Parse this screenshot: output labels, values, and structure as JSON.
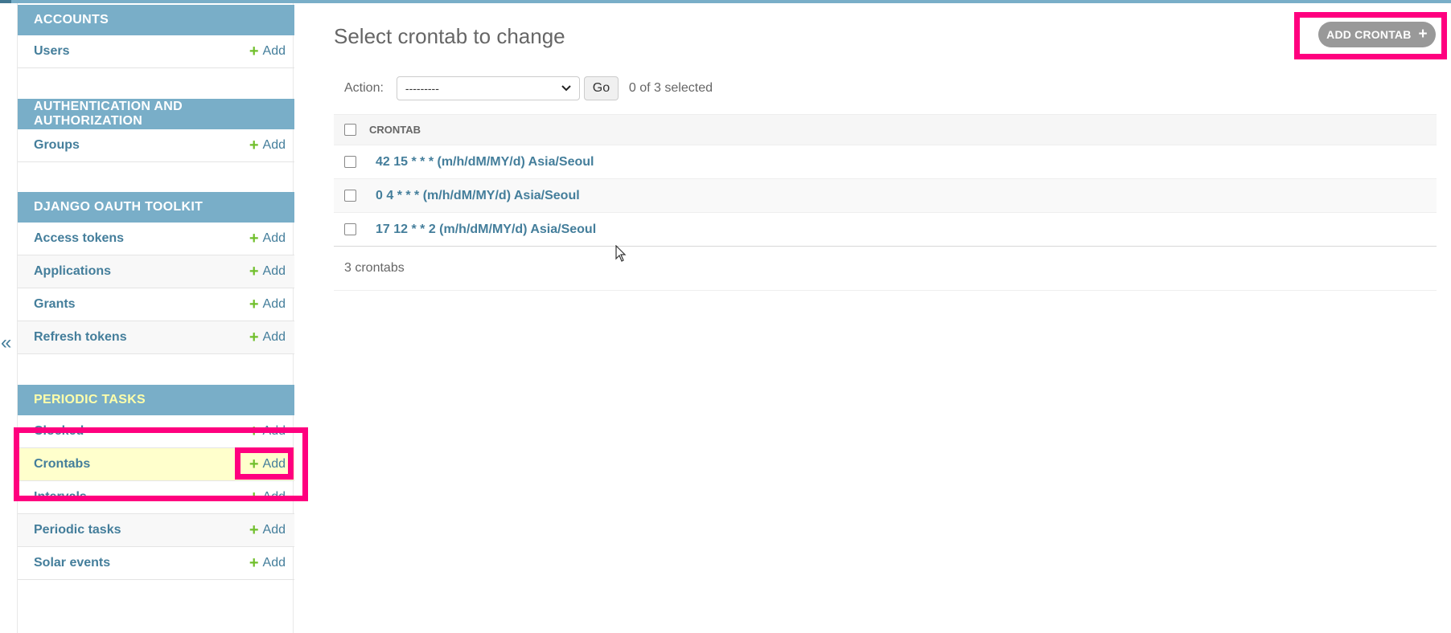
{
  "sidebar": {
    "collapse_toggle": "«",
    "modules": [
      {
        "caption": "ACCOUNTS",
        "rows": [
          {
            "label": "Users",
            "add": "Add"
          }
        ]
      },
      {
        "caption": "AUTHENTICATION AND AUTHORIZATION",
        "rows": [
          {
            "label": "Groups",
            "add": "Add"
          }
        ]
      },
      {
        "caption": "DJANGO OAUTH TOOLKIT",
        "rows": [
          {
            "label": "Access tokens",
            "add": "Add"
          },
          {
            "label": "Applications",
            "add": "Add"
          },
          {
            "label": "Grants",
            "add": "Add"
          },
          {
            "label": "Refresh tokens",
            "add": "Add"
          }
        ]
      },
      {
        "caption": "PERIODIC TASKS",
        "rows": [
          {
            "label": "Clocked",
            "add": "Add"
          },
          {
            "label": "Crontabs",
            "add": "Add"
          },
          {
            "label": "Intervals",
            "add": "Add"
          },
          {
            "label": "Periodic tasks",
            "add": "Add"
          },
          {
            "label": "Solar events",
            "add": "Add"
          }
        ]
      }
    ]
  },
  "main": {
    "title": "Select crontab to change",
    "add_button": "ADD CRONTAB",
    "actions": {
      "label": "Action:",
      "selected": "---------",
      "go": "Go",
      "selection_count": "0 of 3 selected"
    },
    "table": {
      "header": "CRONTAB",
      "rows": [
        "42 15 * * * (m/h/dM/MY/d) Asia/Seoul",
        "0 4 * * * (m/h/dM/MY/d) Asia/Seoul",
        "17 12 * * 2 (m/h/dM/MY/d) Asia/Seoul"
      ]
    },
    "paginator": "3 crontabs"
  },
  "colors": {
    "header_blue": "#79aec8",
    "link_blue": "#447e9b",
    "add_green": "#70bf2b",
    "highlight_pink": "#ff007f",
    "selected_row": "#ffffcc"
  }
}
